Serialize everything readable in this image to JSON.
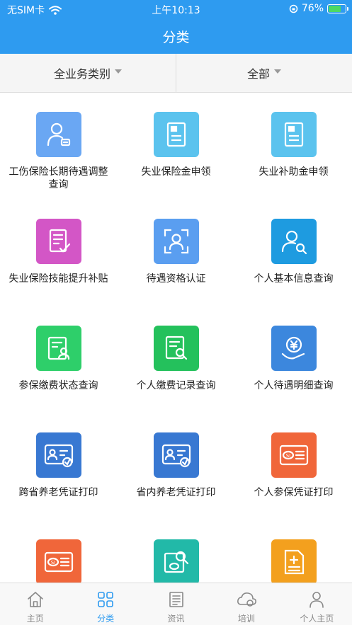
{
  "status_bar": {
    "carrier": "无SIM卡",
    "time": "上午10:13",
    "battery": "76%",
    "battery_level": 0.76
  },
  "header": {
    "title": "分类"
  },
  "filters": [
    {
      "label": "全业务类别"
    },
    {
      "label": "全部"
    }
  ],
  "services": [
    {
      "label": "工伤保险长期待遇调整查询",
      "icon": "person-card-icon",
      "color": "#6AA7F3"
    },
    {
      "label": "失业保险金申领",
      "icon": "document-icon",
      "color": "#5BC3EE"
    },
    {
      "label": "失业补助金申领",
      "icon": "document-icon",
      "color": "#5BC3EE"
    },
    {
      "label": "失业保险技能提升补贴",
      "icon": "checklist-icon",
      "color": "#D356C6"
    },
    {
      "label": "待遇资格认证",
      "icon": "face-scan-icon",
      "color": "#5A9EF0"
    },
    {
      "label": "个人基本信息查询",
      "icon": "person-search-icon",
      "color": "#1E9BE0"
    },
    {
      "label": "参保缴费状态查询",
      "icon": "person-document-icon",
      "color": "#2ECF6A"
    },
    {
      "label": "个人缴费记录查询",
      "icon": "document-search-icon",
      "color": "#24C15C"
    },
    {
      "label": "个人待遇明细查询",
      "icon": "yuan-hand-icon",
      "color": "#3C87DD"
    },
    {
      "label": "跨省养老凭证打印",
      "icon": "id-card-icon",
      "color": "#3878D2"
    },
    {
      "label": "省内养老凭证打印",
      "icon": "id-card-icon",
      "color": "#3878D2"
    },
    {
      "label": "个人参保凭证打印",
      "icon": "si-card-icon",
      "color": "#F0663A"
    },
    {
      "label": "",
      "icon": "si-card-icon",
      "color": "#F0663A"
    },
    {
      "label": "",
      "icon": "si-search-icon",
      "color": "#22B9A8"
    },
    {
      "label": "",
      "icon": "plus-document-icon",
      "color": "#F3A01E"
    }
  ],
  "tabs": [
    {
      "label": "主页",
      "icon": "home-icon",
      "active": false
    },
    {
      "label": "分类",
      "icon": "grid-icon",
      "active": true
    },
    {
      "label": "资讯",
      "icon": "news-icon",
      "active": false
    },
    {
      "label": "培训",
      "icon": "cloud-icon",
      "active": false
    },
    {
      "label": "个人主页",
      "icon": "person-icon",
      "active": false
    }
  ]
}
